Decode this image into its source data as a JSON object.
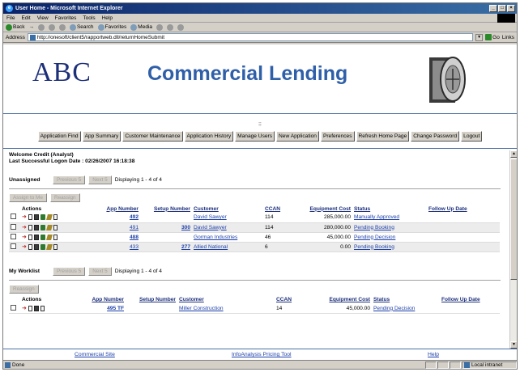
{
  "window": {
    "title": "User Home - Microsoft Internet Explorer",
    "controls": [
      "_",
      "□",
      "×"
    ]
  },
  "menu": [
    "File",
    "Edit",
    "View",
    "Favorites",
    "Tools",
    "Help"
  ],
  "toolbar": {
    "back": "Back",
    "forward": "→",
    "search": "Search",
    "favorites": "Favorites",
    "media": "Media"
  },
  "address": {
    "label": "Address",
    "url": "http://onesoft/client5/rapportweb.dll/returnHomeSubmit",
    "go": "Go",
    "links": "Links"
  },
  "banner": {
    "logo": "ABC",
    "title": "Commercial Lending"
  },
  "nav": {
    "grip": "⠿",
    "buttons": [
      "Application Find",
      "App Summary",
      "Customer Maintenance",
      "Application History",
      "Manage Users",
      "New Application",
      "Preferences",
      "Refresh Home Page",
      "Change Password",
      "Logout"
    ]
  },
  "welcome": {
    "line1": "Welcome Credit (Analyst)",
    "line2": "Last Successful Logon Date : 02/26/2007 16:18:38"
  },
  "unassigned": {
    "label": "Unassigned",
    "previous": "Previous 5",
    "next": "Next 5",
    "display": "Displaying 1 - 4 of 4",
    "assign_to_me": "Assign to Me",
    "reassign": "Reassign",
    "columns": {
      "actions": "Actions",
      "app_number": "App Number",
      "setup_number": "Setup Number",
      "customer": "Customer",
      "ccan": "CCAN",
      "equipment_cost": "Equipment Cost",
      "status": "Status",
      "follow_up": "Follow Up Date"
    },
    "rows": [
      {
        "app": "492",
        "setup": "",
        "customer": "David Sawyer",
        "ccan": "114",
        "cost": "285,000.00",
        "status": "Manually Approved",
        "follow": ""
      },
      {
        "app": "491",
        "setup": "300",
        "customer": "David Sawyer",
        "ccan": "114",
        "cost": "280,000.00",
        "status": "Pending Booking",
        "follow": ""
      },
      {
        "app": "488",
        "setup": "",
        "customer": "Gorman Industries",
        "ccan": "46",
        "cost": "45,000.00",
        "status": "Pending Decision",
        "follow": ""
      },
      {
        "app": "433",
        "setup": "277",
        "customer": "Allied National",
        "ccan": "6",
        "cost": "0.00",
        "status": "Pending Booking",
        "follow": ""
      }
    ]
  },
  "worklist": {
    "label": "My Worklist",
    "previous": "Previous 5",
    "next": "Next 5",
    "display": "Displaying 1 - 4 of 4",
    "reassign": "Reassign",
    "columns": {
      "actions": "Actions",
      "app_number": "App Number",
      "setup_number": "Setup Number",
      "customer": "Customer",
      "ccan": "CCAN",
      "equipment_cost": "Equipment Cost",
      "status": "Status",
      "follow_up": "Follow Up Date"
    },
    "rows": [
      {
        "app": "495 TF",
        "setup": "",
        "customer": "Miller Construction",
        "ccan": "14",
        "cost": "45,000.00",
        "status": "Pending Decision",
        "follow": ""
      }
    ]
  },
  "footer": {
    "link1": "Commercial Site",
    "link2": "InfoAnalysis Pricing Tool",
    "link3": "Help"
  },
  "status": {
    "text": "Done",
    "zone": "Local intranet"
  }
}
